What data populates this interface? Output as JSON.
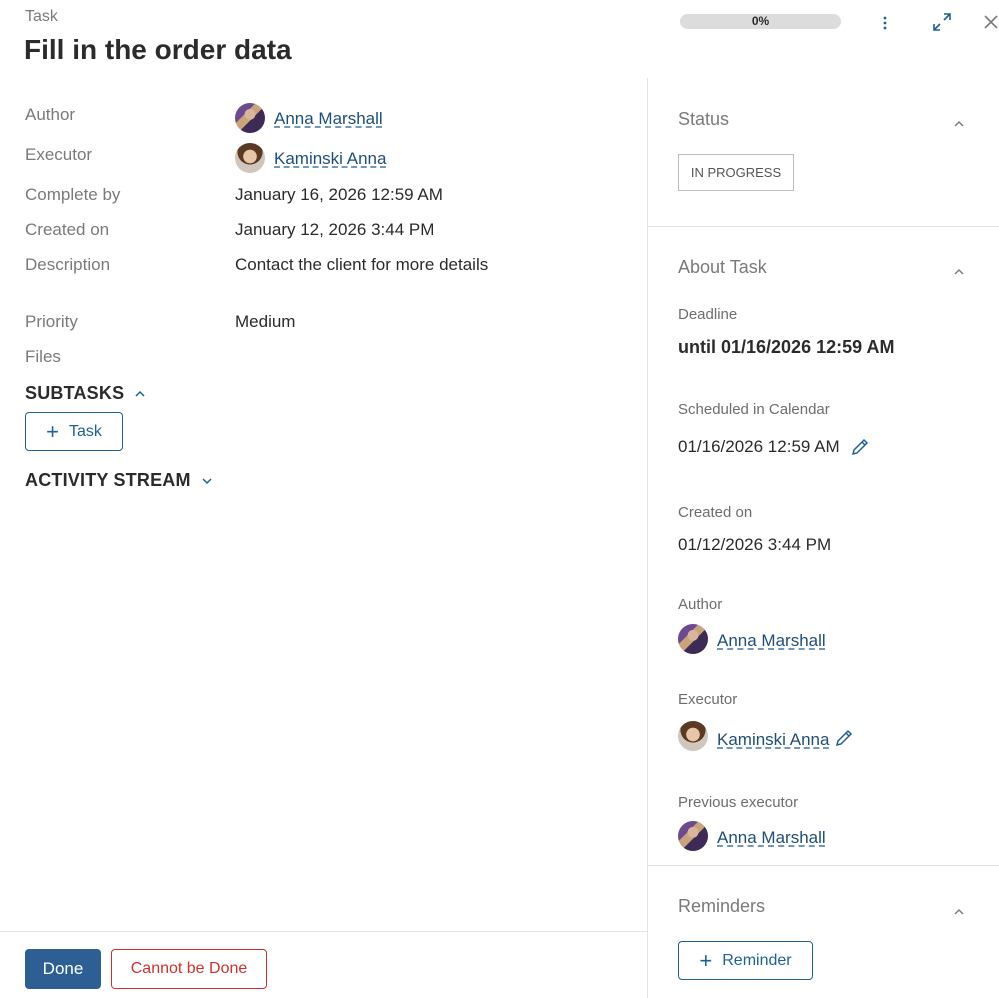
{
  "header": {
    "overline": "Task",
    "title": "Fill in the order data",
    "progress_label": "0%",
    "progress_value": 0
  },
  "details": {
    "author_label": "Author",
    "author_name": "Anna Marshall",
    "executor_label": "Executor",
    "executor_name": "Kaminski Anna",
    "complete_by_label": "Complete by",
    "complete_by_value": "January 16, 2026 12:59 AM",
    "created_on_label": "Created on",
    "created_on_value": "January 12, 2026 3:44 PM",
    "description_label": "Description",
    "description_value": "Contact the client for more details",
    "priority_label": "Priority",
    "priority_value": "Medium",
    "files_label": "Files"
  },
  "subtasks": {
    "heading": "SUBTASKS",
    "add_task_label": "Task"
  },
  "activity": {
    "heading": "ACTIVITY STREAM"
  },
  "footer": {
    "done_label": "Done",
    "cannot_label": "Cannot be Done"
  },
  "sidebar": {
    "status_title": "Status",
    "status_value": "IN PROGRESS",
    "about_title": "About Task",
    "deadline_label": "Deadline",
    "deadline_value": "until 01/16/2026 12:59 AM",
    "scheduled_label": "Scheduled in Calendar",
    "scheduled_value": "01/16/2026 12:59 AM",
    "created_label": "Created on",
    "created_value": "01/12/2026 3:44 PM",
    "author_label": "Author",
    "author_name": "Anna Marshall",
    "executor_label": "Executor",
    "executor_name": "Kaminski Anna",
    "prev_executor_label": "Previous executor",
    "prev_executor_name": "Anna Marshall",
    "reminders_title": "Reminders",
    "reminder_button": "Reminder"
  },
  "colors": {
    "primary": "#2e5f94",
    "danger": "#d0312d",
    "link": "#1f4e79"
  }
}
